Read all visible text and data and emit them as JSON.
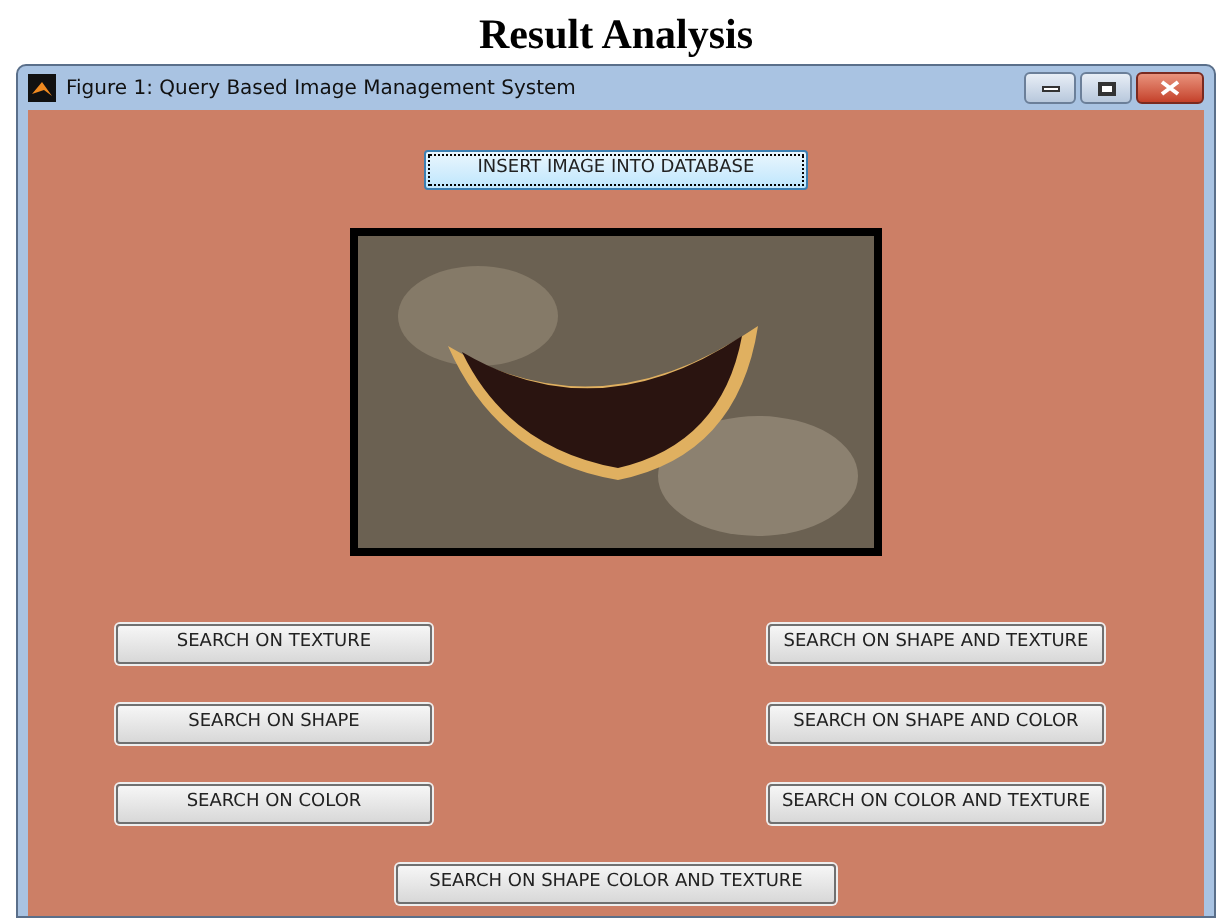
{
  "heading": "Result Analysis",
  "window": {
    "title": "Figure 1: Query Based Image Management System"
  },
  "insert_button": {
    "label": "INSERT IMAGE INTO DATABASE",
    "focused": true
  },
  "search_buttons": [
    {
      "label": "SEARCH ON TEXTURE"
    },
    {
      "label": "SEARCH ON SHAPE AND TEXTURE"
    },
    {
      "label": "SEARCH ON SHAPE"
    },
    {
      "label": "SEARCH ON SHAPE AND COLOR"
    },
    {
      "label": "SEARCH ON COLOR"
    },
    {
      "label": "SEARCH ON COLOR AND TEXTURE"
    }
  ],
  "bottom_button": {
    "label": "SEARCH ON SHAPE COLOR AND TEXTURE"
  }
}
